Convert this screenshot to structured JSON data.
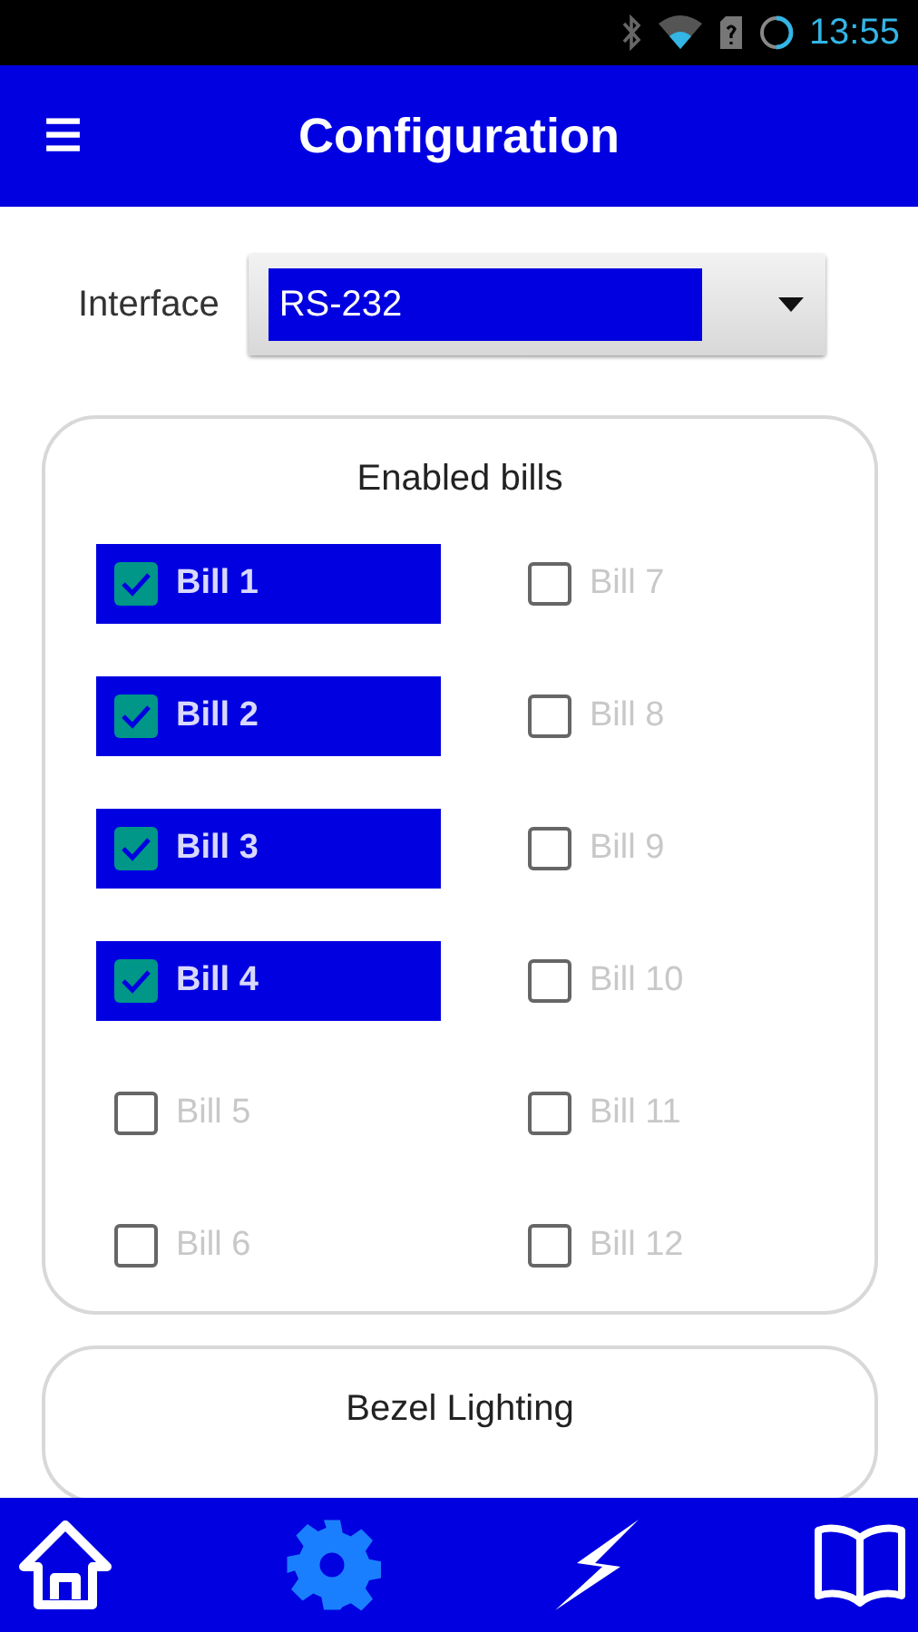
{
  "status_bar": {
    "time": "13:55"
  },
  "header": {
    "menu_icon": "☰",
    "title": "Configuration"
  },
  "interface": {
    "label": "Interface",
    "value": "RS-232"
  },
  "enabled_bills": {
    "title": "Enabled bills",
    "bills": [
      {
        "label": "Bill 1",
        "checked": true
      },
      {
        "label": "Bill 7",
        "checked": false
      },
      {
        "label": "Bill 2",
        "checked": true
      },
      {
        "label": "Bill 8",
        "checked": false
      },
      {
        "label": "Bill 3",
        "checked": true
      },
      {
        "label": "Bill 9",
        "checked": false
      },
      {
        "label": "Bill 4",
        "checked": true
      },
      {
        "label": "Bill 10",
        "checked": false
      },
      {
        "label": "Bill 5",
        "checked": false
      },
      {
        "label": "Bill 11",
        "checked": false
      },
      {
        "label": "Bill 6",
        "checked": false
      },
      {
        "label": "Bill 12",
        "checked": false
      }
    ]
  },
  "bezel_lighting": {
    "title": "Bezel Lighting"
  },
  "bottom_nav": [
    {
      "kind": "home",
      "selected": false
    },
    {
      "kind": "settings",
      "selected": true
    },
    {
      "kind": "bolt",
      "selected": false
    },
    {
      "kind": "book",
      "selected": false
    }
  ]
}
